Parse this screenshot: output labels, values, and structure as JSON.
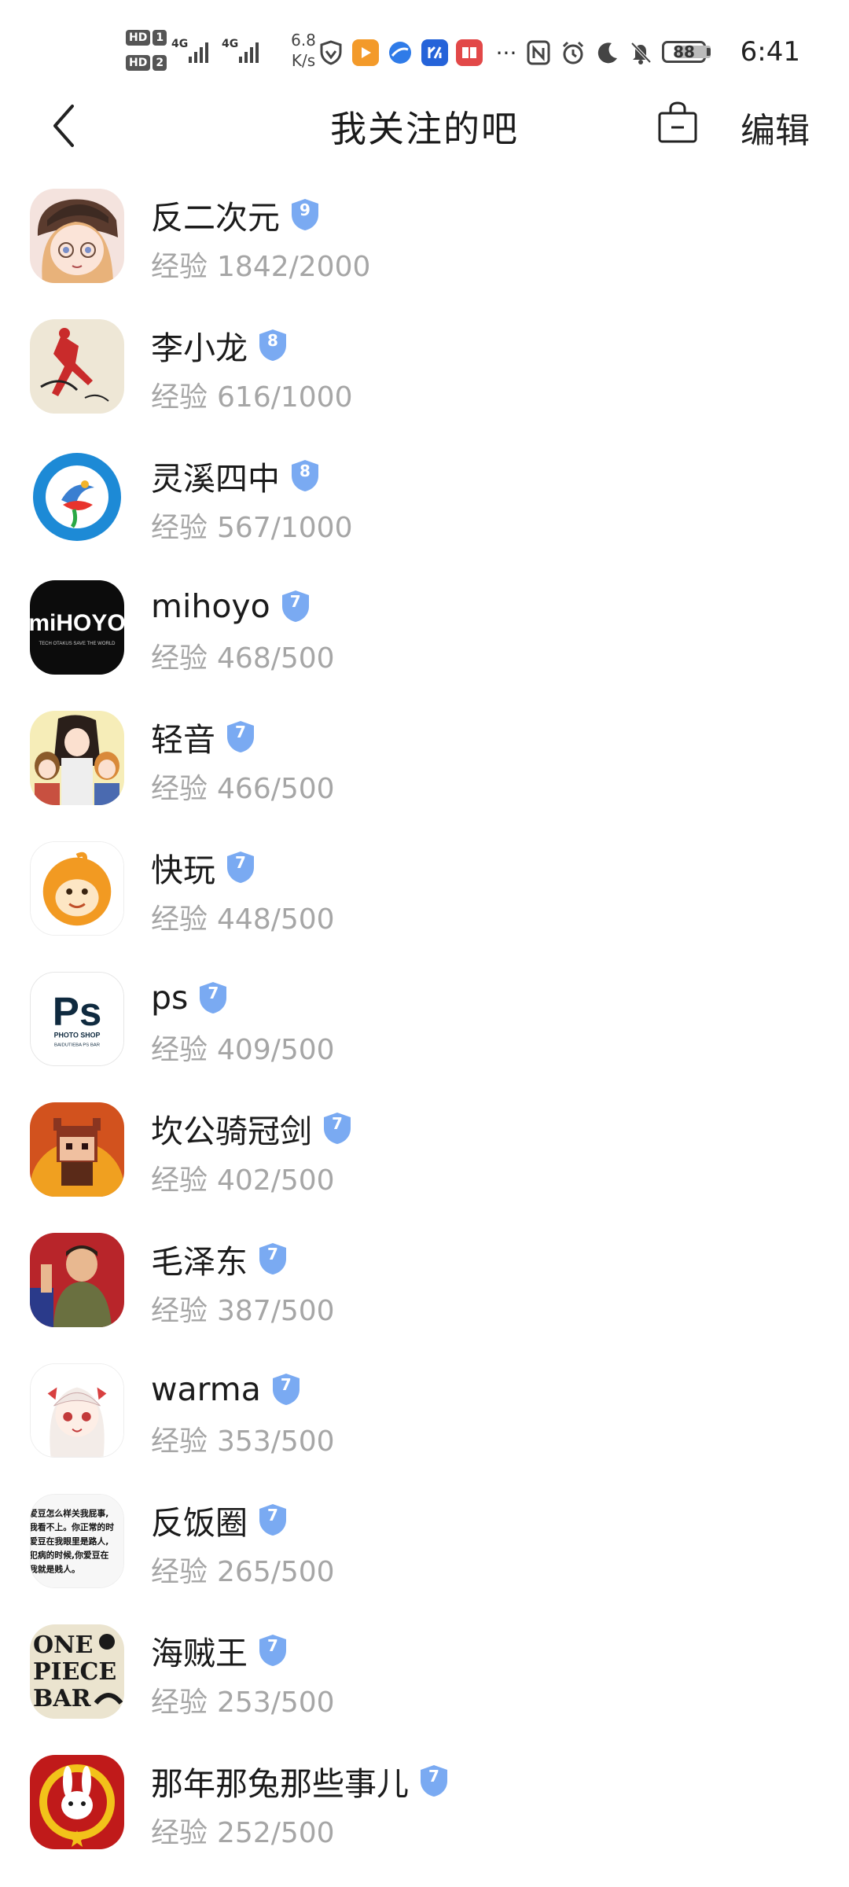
{
  "status_bar": {
    "hd1": "HD",
    "sim1": "1",
    "hd2": "HD",
    "sim2": "2",
    "net1": "4G",
    "net2": "4G",
    "speed_value": "6.8",
    "speed_unit": "K/s",
    "more": "···",
    "battery": "88",
    "time": "6:41",
    "icons": [
      "shield-icon",
      "video-app-icon",
      "browser-icon",
      "app-icon",
      "reader-icon",
      "nfc-icon",
      "alarm-icon",
      "moon-icon",
      "mute-bell-icon"
    ]
  },
  "header": {
    "title": "我关注的吧",
    "edit_label": "编辑"
  },
  "exp_label": "经验",
  "colors": {
    "badge": "#7aaaf2",
    "secondary_text": "#a6a6a6",
    "primary_text": "#1b1b1b"
  },
  "forums": [
    {
      "name": "反二次元",
      "level": "9",
      "exp": "1842/2000"
    },
    {
      "name": "李小龙",
      "level": "8",
      "exp": "616/1000"
    },
    {
      "name": "灵溪四中",
      "level": "8",
      "exp": "567/1000"
    },
    {
      "name": "mihoyo",
      "level": "7",
      "exp": "468/500"
    },
    {
      "name": "轻音",
      "level": "7",
      "exp": "466/500"
    },
    {
      "name": "快玩",
      "level": "7",
      "exp": "448/500"
    },
    {
      "name": "ps",
      "level": "7",
      "exp": "409/500"
    },
    {
      "name": "坎公骑冠剑",
      "level": "7",
      "exp": "402/500"
    },
    {
      "name": "毛泽东",
      "level": "7",
      "exp": "387/500"
    },
    {
      "name": "warma",
      "level": "7",
      "exp": "353/500"
    },
    {
      "name": "反饭圈",
      "level": "7",
      "exp": "265/500"
    },
    {
      "name": "海贼王",
      "level": "7",
      "exp": "253/500"
    },
    {
      "name": "那年那兔那些事儿",
      "level": "7",
      "exp": "252/500"
    }
  ],
  "avatar_text": {
    "mihoyo": "miHOYO",
    "mihoyo_sub": "TECH OTAKUS SAVE THE WORLD",
    "ps_big": "Ps",
    "ps_sub1": "PHOTO SHOP",
    "ps_sub2": "BAIDUTIEBA PS BAR",
    "onepiece1": "ONE",
    "onepiece2": "PIECE",
    "onepiece3": "BAR",
    "fanfan1": "爱豆怎么样关我屁事,",
    "fanfan2": "我看不上。你正常的时",
    "fanfan3": "爱豆在我眼里是路人,",
    "fanfan4": "犯病的时候,你爱豆在",
    "fanfan5": "我就是贱人。"
  }
}
